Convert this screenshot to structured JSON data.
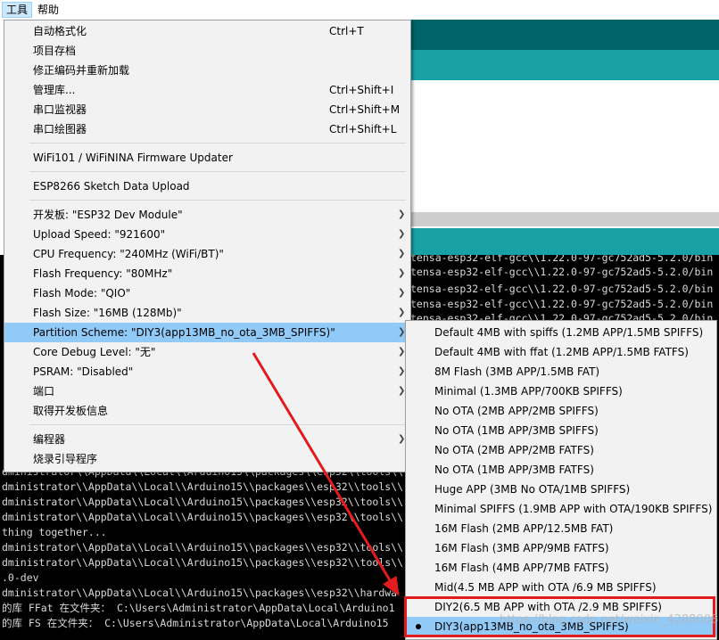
{
  "menubar": {
    "tools": "工具",
    "help": "帮助"
  },
  "tools_menu": {
    "items": [
      {
        "label": "自动格式化",
        "shortcut": "Ctrl+T"
      },
      {
        "label": "项目存档",
        "shortcut": ""
      },
      {
        "label": "修正编码并重新加载",
        "shortcut": ""
      },
      {
        "label": "管理库...",
        "shortcut": "Ctrl+Shift+I"
      },
      {
        "label": "串口监视器",
        "shortcut": "Ctrl+Shift+M"
      },
      {
        "label": "串口绘图器",
        "shortcut": "Ctrl+Shift+L"
      },
      {
        "label": "WiFi101 / WiFiNINA Firmware Updater",
        "shortcut": ""
      },
      {
        "label": "ESP8266 Sketch Data Upload",
        "shortcut": ""
      },
      {
        "label": "开发板: \"ESP32 Dev Module\"",
        "shortcut": ""
      },
      {
        "label": "Upload Speed: \"921600\"",
        "shortcut": ""
      },
      {
        "label": "CPU Frequency: \"240MHz (WiFi/BT)\"",
        "shortcut": ""
      },
      {
        "label": "Flash Frequency: \"80MHz\"",
        "shortcut": ""
      },
      {
        "label": "Flash Mode: \"QIO\"",
        "shortcut": ""
      },
      {
        "label": "Flash Size: \"16MB (128Mb)\"",
        "shortcut": ""
      },
      {
        "label": "Partition Scheme: \"DIY3(app13MB_no_ota_3MB_SPIFFS)\"",
        "shortcut": ""
      },
      {
        "label": "Core Debug Level: \"无\"",
        "shortcut": ""
      },
      {
        "label": "PSRAM: \"Disabled\"",
        "shortcut": ""
      },
      {
        "label": "端口",
        "shortcut": ""
      },
      {
        "label": "取得开发板信息",
        "shortcut": ""
      },
      {
        "label": "编程器",
        "shortcut": ""
      },
      {
        "label": "烧录引导程序",
        "shortcut": ""
      }
    ]
  },
  "partition_menu": {
    "items": [
      {
        "label": "Default 4MB with spiffs (1.2MB APP/1.5MB SPIFFS)"
      },
      {
        "label": "Default 4MB with ffat (1.2MB APP/1.5MB FATFS)"
      },
      {
        "label": "8M Flash (3MB APP/1.5MB FAT)"
      },
      {
        "label": "Minimal (1.3MB APP/700KB SPIFFS)"
      },
      {
        "label": "No OTA (2MB APP/2MB SPIFFS)"
      },
      {
        "label": "No OTA (1MB APP/3MB SPIFFS)"
      },
      {
        "label": "No OTA (2MB APP/2MB FATFS)"
      },
      {
        "label": "No OTA (1MB APP/3MB FATFS)"
      },
      {
        "label": "Huge APP (3MB No OTA/1MB SPIFFS)"
      },
      {
        "label": "Minimal SPIFFS (1.9MB APP with OTA/190KB SPIFFS)"
      },
      {
        "label": "16M Flash (2MB APP/12.5MB FAT)"
      },
      {
        "label": "16M Flash (3MB APP/9MB FATFS)"
      },
      {
        "label": "16M Flash (4MB APP/7MB FATFS)"
      },
      {
        "label": "Mid(4.5 MB APP with OTA /6.9 MB SPIFFS)"
      },
      {
        "label": "DIY2(6.5 MB APP with OTA /2.9 MB SPIFFS)"
      },
      {
        "label": "DIY3(app13MB_no_ota_3MB_SPIFFS)"
      }
    ],
    "selected": "DIY3(app13MB_no_ota_3MB_SPIFFS)"
  },
  "console": {
    "right_lines": [
      "tensa-esp32-elf-gcc\\\\1.22.0-97-gc752ad5-5.2.0/bin",
      "tensa-esp32-elf-gcc\\\\1.22.0-97-gc752ad5-5.2.0/bin",
      "tensa-esp32-elf-gcc\\\\1.22.0-97-gc752ad5-5.2.0/bin",
      "tensa-esp32-elf-gcc\\\\1.22.0-97-gc752ad5-5.2.0/bin",
      "tensa-esp32-elf-gcc\\\\1.22.0-97-gc752ad5-5.2.0/bin"
    ],
    "left_lines": [
      "dministrator\\\\AppData\\\\Local\\\\Arduino15\\\\packages\\\\esp32\\\\tools\\\\",
      "dministrator\\\\AppData\\\\Local\\\\Arduino15\\\\packages\\\\esp32\\\\tools\\\\",
      "dministrator\\\\AppData\\\\Local\\\\Arduino15\\\\packages\\\\esp32\\\\tools\\\\",
      "dministrator\\\\AppData\\\\Local\\\\Arduino15\\\\packages\\\\esp32\\\\tools\\\\",
      "thing together...",
      "dministrator\\\\AppData\\\\Local\\\\Arduino15\\\\packages\\\\esp32\\\\tools\\\\",
      "dministrator\\\\AppData\\\\Local\\\\Arduino15\\\\packages\\\\esp32\\\\tools\\\\",
      ".0-dev",
      "dministrator\\\\AppData\\\\Local\\\\Arduino15\\\\packages\\\\esp32\\\\hardwa",
      "的库 FFat 在文件夹： C:\\Users\\Administrator\\AppData\\Local\\Arduino1",
      "的库 FS 在文件夹： C:\\Users\\Administrator\\AppData\\Local\\Arduino15"
    ]
  },
  "watermark": "https://blog.csdn.net/weixin_42880082",
  "colors": {
    "highlight": "#91c9f7",
    "annotation_red": "#e21c1c",
    "teal_dark": "#006468",
    "teal": "#17a1a5"
  }
}
